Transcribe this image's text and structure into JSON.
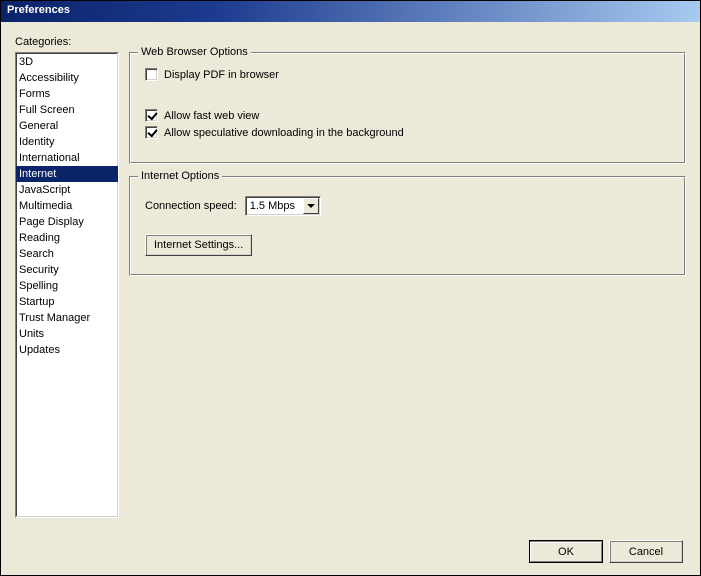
{
  "window": {
    "title": "Preferences"
  },
  "categories": {
    "label": "Categories:",
    "items": [
      "3D",
      "Accessibility",
      "Forms",
      "Full Screen",
      "General",
      "Identity",
      "International",
      "Internet",
      "JavaScript",
      "Multimedia",
      "Page Display",
      "Reading",
      "Search",
      "Security",
      "Spelling",
      "Startup",
      "Trust Manager",
      "Units",
      "Updates"
    ],
    "selected_index": 7
  },
  "group_browser": {
    "legend": "Web Browser Options",
    "display_pdf": {
      "label": "Display PDF in browser",
      "checked": false
    },
    "fast_web": {
      "label": "Allow fast web view",
      "checked": true
    },
    "speculative": {
      "label": "Allow speculative downloading in the background",
      "checked": true
    }
  },
  "group_internet": {
    "legend": "Internet Options",
    "speed_label": "Connection speed:",
    "speed_value": "1.5 Mbps",
    "settings_button": "Internet Settings..."
  },
  "footer": {
    "ok": "OK",
    "cancel": "Cancel"
  }
}
